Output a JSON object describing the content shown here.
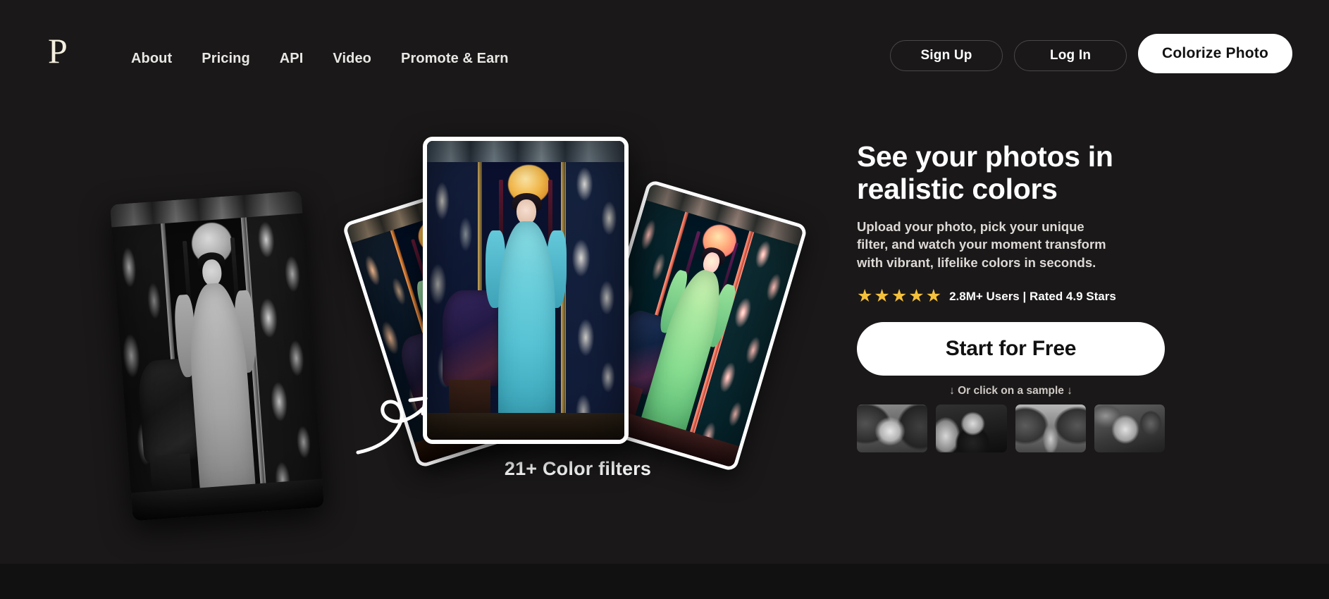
{
  "brand": {
    "logo_letter": "P"
  },
  "nav": {
    "links": [
      {
        "label": "About"
      },
      {
        "label": "Pricing"
      },
      {
        "label": "API"
      },
      {
        "label": "Video"
      },
      {
        "label": "Promote & Earn"
      }
    ],
    "sign_up_label": "Sign Up",
    "log_in_label": "Log In",
    "colorize_label": "Colorize Photo"
  },
  "hero": {
    "headline": "See your photos in\nrealistic colors",
    "subtext": "Upload your photo, pick your unique\nfilter, and watch your moment transform\nwith vibrant, lifelike colors in seconds.",
    "stars_glyphs": "★★★★★",
    "rating_text": "2.8M+ Users | Rated 4.9 Stars",
    "cta_label": "Start for Free",
    "sample_hint": "↓ Or click on a sample ↓",
    "filters_caption": "21+ Color filters"
  },
  "samples": [
    {
      "alt": "sample-woman-in-garden"
    },
    {
      "alt": "sample-einstein-at-desk"
    },
    {
      "alt": "sample-garden-path"
    },
    {
      "alt": "sample-migrant-mother"
    }
  ],
  "showcase": {
    "before_alt": "black-and-white-original-photo",
    "after_alt": "colorized-photo-main",
    "variant_left_alt": "colorized-photo-gold-filter",
    "variant_right_alt": "colorized-photo-pink-filter",
    "arrow_alt": "curly-arrow"
  },
  "colors": {
    "background": "#1a1818",
    "accent_white": "#ffffff",
    "star_gold": "#f5c13b",
    "logo_cream": "#f4efdf",
    "text_primary": "#ffffff",
    "text_secondary": "#ddd9d6"
  }
}
